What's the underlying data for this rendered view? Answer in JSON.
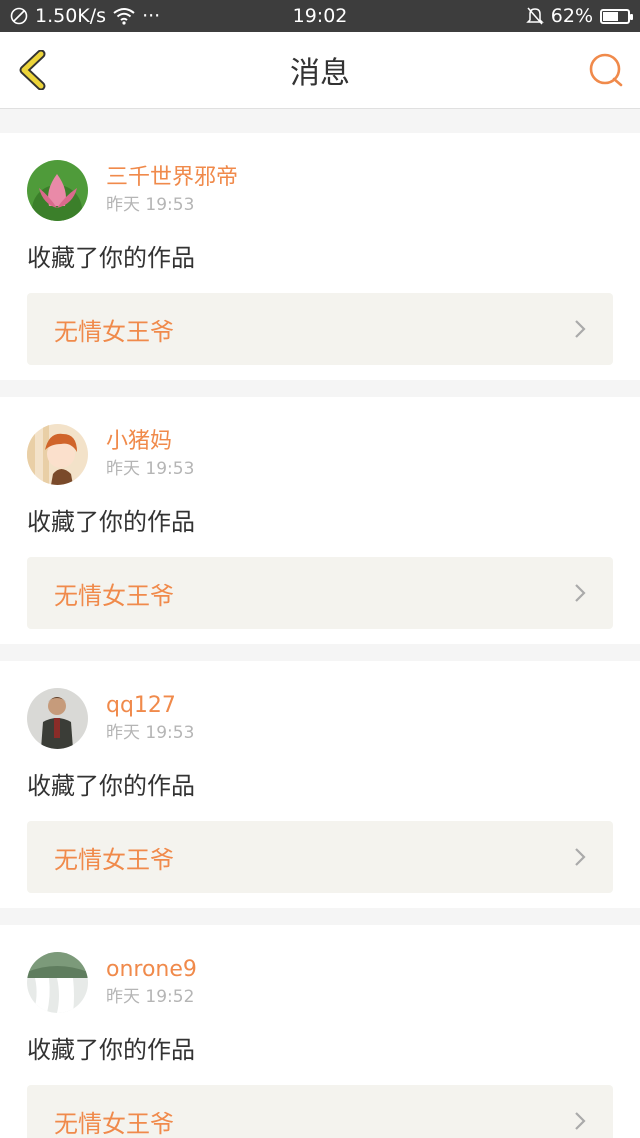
{
  "status_bar": {
    "speed": "1.50K/s",
    "more": "···",
    "time": "19:02",
    "battery": "62%",
    "battery_level": 0.62
  },
  "header": {
    "title": "消息"
  },
  "colors": {
    "accent": "#f08a4b",
    "back_icon": "#ecd43a"
  },
  "messages": [
    {
      "user": "三千世界邪帝",
      "time": "昨天 19:53",
      "action": "收藏了你的作品",
      "work": "无情女王爷",
      "avatar": "lotus-avatar-icon"
    },
    {
      "user": "小猪妈",
      "time": "昨天 19:53",
      "action": "收藏了你的作品",
      "work": "无情女王爷",
      "avatar": "anime-girl-avatar-icon"
    },
    {
      "user": "qq127",
      "time": "昨天 19:53",
      "action": "收藏了你的作品",
      "work": "无情女王爷",
      "avatar": "man-avatar-icon"
    },
    {
      "user": "onrone9",
      "time": "昨天 19:52",
      "action": "收藏了你的作品",
      "work": "无情女王爷",
      "avatar": "waterfall-avatar-icon"
    }
  ]
}
